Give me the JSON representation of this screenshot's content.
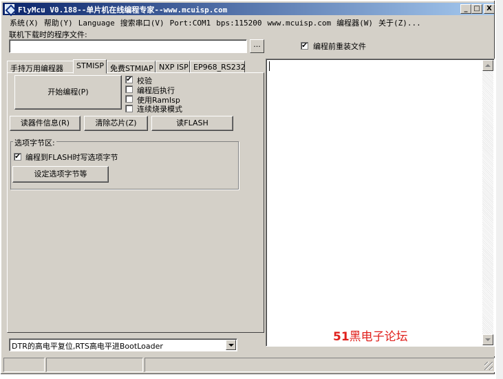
{
  "window": {
    "title": "FlyMcu V0.188--单片机在线编程专家--www.mcuisp.com",
    "controls": {
      "minimize": "_",
      "maximize": "□",
      "close": "X"
    }
  },
  "menu": {
    "items": [
      "系统(X)",
      "帮助(Y)",
      "Language",
      "搜索串口(V)",
      "Port:COM1",
      "bps:115200",
      "www.mcuisp.com",
      "编程器(W)",
      "关于(Z)..."
    ]
  },
  "file_section": {
    "label": "联机下载时的程序文件:",
    "file_value": "",
    "browse_label": "...",
    "reload_checkbox": {
      "label": "编程前重装文件",
      "checked": true
    }
  },
  "tabs": [
    "手持万用编程器",
    "STMISP",
    "免费STMIAP",
    "NXP ISP",
    "EP968_RS232"
  ],
  "active_tab": "STMISP",
  "stmisp": {
    "start_button": "开始编程(P)",
    "options": [
      {
        "label": "校验",
        "checked": true
      },
      {
        "label": "编程后执行",
        "checked": false
      },
      {
        "label": "使用RamIsp",
        "checked": false
      },
      {
        "label": "连续烧录模式",
        "checked": false
      }
    ],
    "read_info_button": "读器件信息(R)",
    "erase_button": "清除芯片(Z)",
    "read_flash_button": "读FLASH",
    "option_bytes": {
      "title": "选项字节区:",
      "write_checkbox": {
        "label": "编程到FLASH时写选项字节",
        "checked": true
      },
      "set_button": "设定选项字节等"
    }
  },
  "reset_mode": {
    "selected": "DTR的高电平复位,RTS高电平进BootLoader"
  },
  "output": {
    "text": "",
    "watermark_num": "51",
    "watermark_text": "黑电子论坛"
  },
  "colors": {
    "face": "#d4d0c8",
    "title_start": "#0a246a",
    "title_end": "#a6caf0",
    "watermark": "#e0201c"
  },
  "icons": {
    "check_mark": "✔"
  }
}
